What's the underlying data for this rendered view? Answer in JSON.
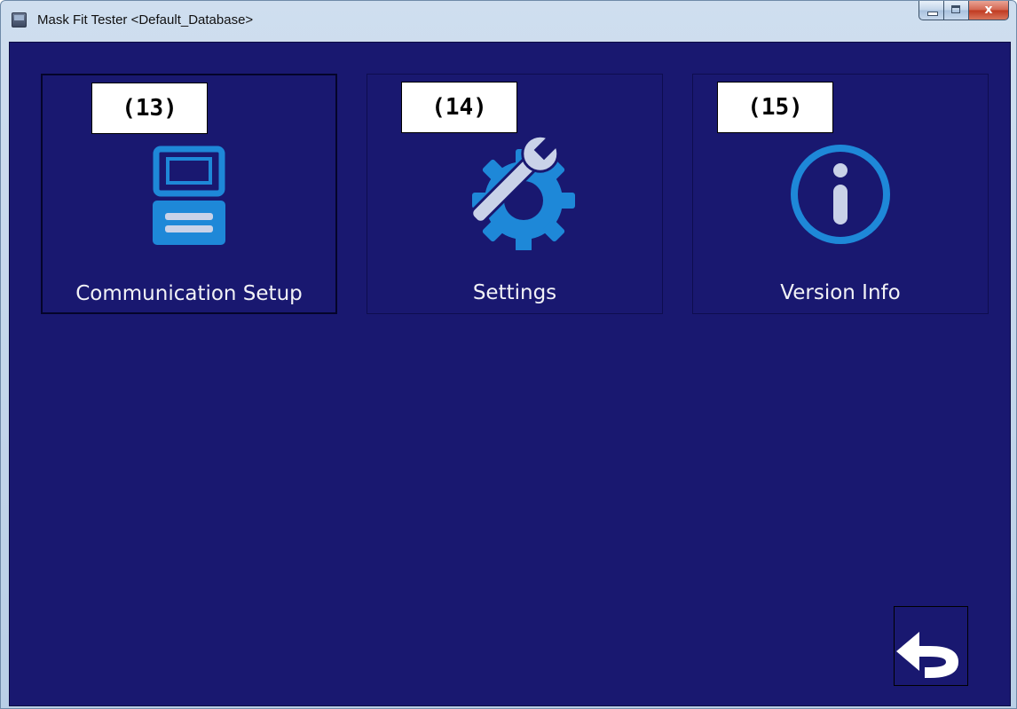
{
  "window": {
    "title": "Mask Fit Tester <Default_Database>",
    "colors": {
      "background": "#191870",
      "icon_blue": "#1e88d8",
      "icon_light": "#c9d2e8",
      "label_text": "#f2f2f6"
    }
  },
  "caption_buttons": {
    "minimize_icon": "minimize-icon",
    "maximize_icon": "maximize-icon",
    "close_glyph": "x"
  },
  "tiles": [
    {
      "callout": "(13)",
      "label": "Communication Setup",
      "icon": "communication-device-icon",
      "focused": true
    },
    {
      "callout": "(14)",
      "label": "Settings",
      "icon": "wrench-gear-icon",
      "focused": false
    },
    {
      "callout": "(15)",
      "label": "Version Info",
      "icon": "info-icon",
      "focused": false
    }
  ],
  "back_button": {
    "icon": "back-arrow-icon"
  }
}
